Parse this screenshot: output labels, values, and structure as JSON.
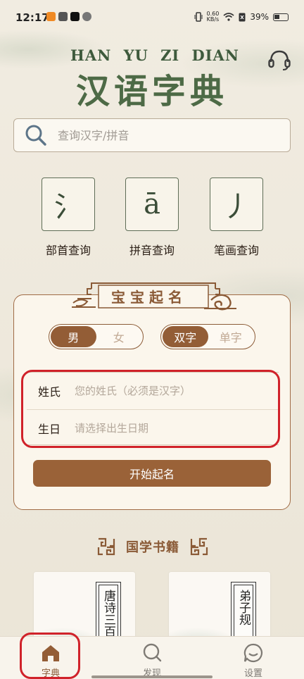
{
  "status_bar": {
    "time": "12:17",
    "net_speed_value": "0.60",
    "net_speed_unit": "KB/s",
    "battery": "39%"
  },
  "header": {
    "pinyin": [
      "HAN",
      "YU",
      "ZI",
      "DIAN"
    ],
    "title": "汉语字典",
    "support_icon": "headset-icon"
  },
  "search": {
    "placeholder": "查询汉字/拼音"
  },
  "tools": [
    {
      "glyph": "氵",
      "label": "部首查询"
    },
    {
      "glyph": "ā",
      "label": "拼音查询"
    },
    {
      "glyph": "丿",
      "label": "笔画查询"
    }
  ],
  "naming": {
    "banner": "宝宝起名",
    "gender": {
      "options": [
        "男",
        "女"
      ],
      "selected": "男"
    },
    "char_count": {
      "options": [
        "双字",
        "单字"
      ],
      "selected": "双字"
    },
    "surname": {
      "label": "姓氏",
      "placeholder": "您的姓氏（必须是汉字）"
    },
    "birthday": {
      "label": "生日",
      "placeholder": "请选择出生日期"
    },
    "start_button": "开始起名"
  },
  "classics": {
    "title": "国学书籍",
    "books": [
      {
        "title": "唐诗三百"
      },
      {
        "title": "弟子规"
      }
    ]
  },
  "bottom_nav": {
    "items": [
      {
        "label": "字典",
        "icon": "home-icon",
        "active": true
      },
      {
        "label": "发现",
        "icon": "search-icon",
        "active": false
      },
      {
        "label": "设置",
        "icon": "chat-icon",
        "active": false
      }
    ]
  },
  "colors": {
    "accent_brown": "#935d36",
    "title_green": "#4d6a46",
    "highlight_red": "#d0222a"
  }
}
